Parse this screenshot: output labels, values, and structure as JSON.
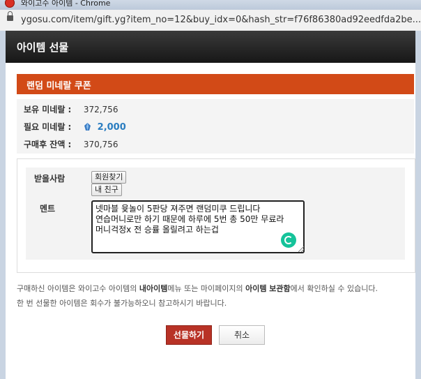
{
  "browser": {
    "window_title": "와이고수 아이템 - Chrome",
    "url": "ygosu.com/item/gift.yg?item_no=12&buy_idx=0&hash_str=f76f86380ad92eedfda2be..."
  },
  "dialog": {
    "title": "아이템 선물",
    "coupon_name": "랜덤 미네랄 쿠폰",
    "info": {
      "owned_label": "보유 미네랄 :",
      "owned_value": "372,756",
      "required_label": "필요 미네랄 :",
      "required_value": "2,000",
      "balance_label": "구매후 잔액 :",
      "balance_value": "370,756"
    },
    "form": {
      "recipient_label": "받을사람",
      "member_search_button": "회원찾기",
      "my_friends_button": "내 친구",
      "message_label": "멘트",
      "message_value": "넷마블 윷놀이 5판당 져주면 랜덤미쿠 드립니다\n연습머니로만 하기 때문에 하루에 5번 총 50만 무료라\n머니걱정x 전 승률 올릴려고 하는겁"
    },
    "notice": {
      "line1_a": "구매하신 아이템은 와이고수 아이템의 ",
      "line1_b": "내아이템",
      "line1_c": "메뉴 또는 마이페이지의 ",
      "line1_d": "아이템 보관함",
      "line1_e": "에서 확인하실 수 있습니다.",
      "line2": "한 번 선물한 아이템은 회수가 불가능하오니 참고하시기 바랍니다."
    },
    "buttons": {
      "gift": "선물하기",
      "cancel": "취소"
    }
  },
  "colors": {
    "accent": "#d24a17",
    "primary_button": "#b83226",
    "mineral_value": "#2a7dc0",
    "header": "#1f1f1f"
  }
}
